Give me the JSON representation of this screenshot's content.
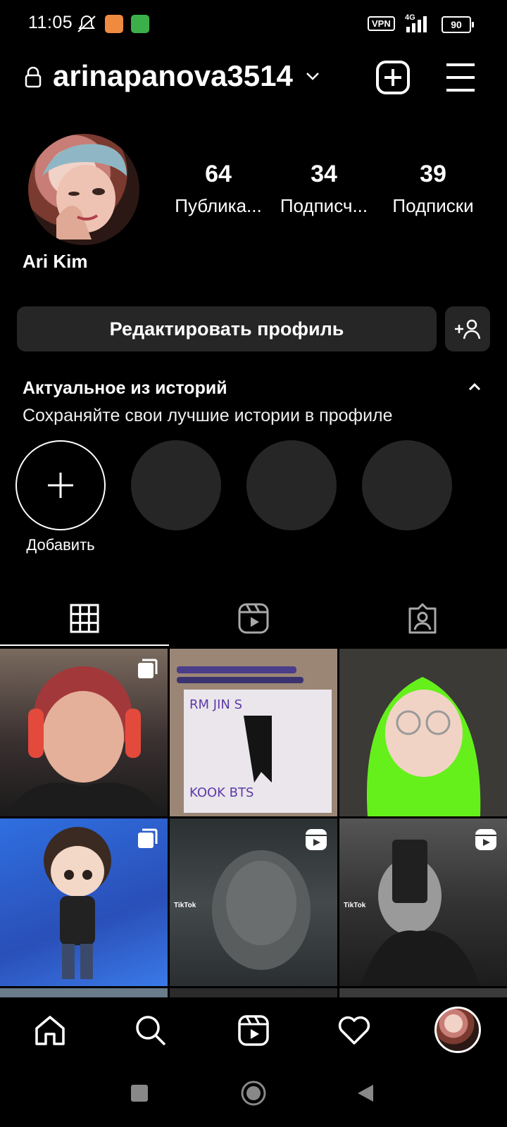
{
  "status_bar": {
    "time": "11:05",
    "vpn": "VPN",
    "network": "4G",
    "battery": "90"
  },
  "header": {
    "username": "arinapanova3514",
    "icons": [
      "lock-icon",
      "chevron-down-icon",
      "create-icon",
      "menu-icon"
    ]
  },
  "profile": {
    "display_name": "Ari Kim",
    "stats": [
      {
        "value": "64",
        "label": "Публика..."
      },
      {
        "value": "34",
        "label": "Подписч..."
      },
      {
        "value": "39",
        "label": "Подписки"
      }
    ],
    "edit_label": "Редактировать профиль"
  },
  "highlights": {
    "title": "Актуальное из историй",
    "subtitle": "Сохраняйте свои лучшие истории в профиле",
    "add_label": "Добавить"
  },
  "tabs": [
    "grid-icon",
    "reels-icon",
    "tagged-icon"
  ],
  "grid": {
    "tiktok_label": "TikTok"
  },
  "colors": {
    "background": "#000000",
    "button": "#262626",
    "text": "#ffffff"
  }
}
